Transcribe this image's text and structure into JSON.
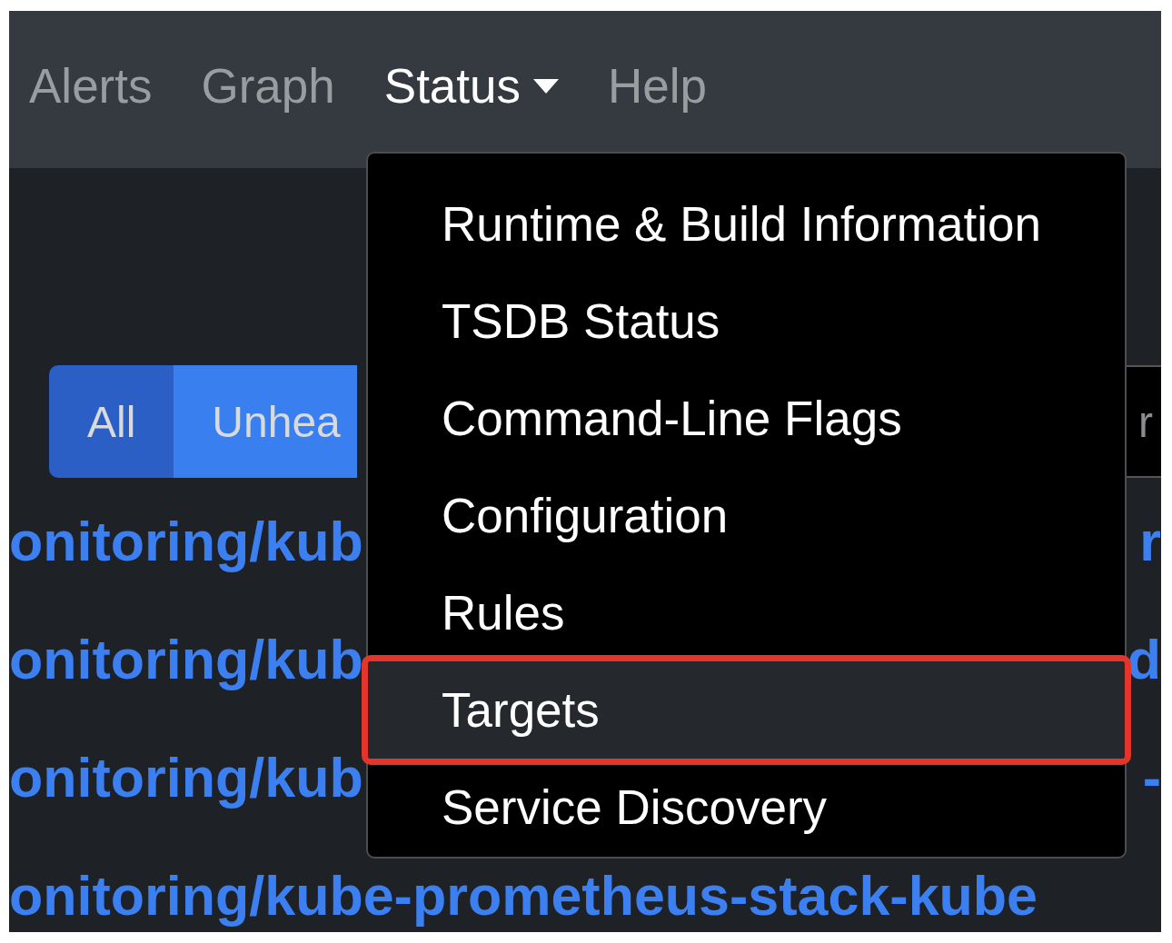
{
  "navbar": {
    "items": [
      {
        "label": "Alerts",
        "kind": "link",
        "active": false
      },
      {
        "label": "Graph",
        "kind": "link",
        "active": false
      },
      {
        "label": "Status",
        "kind": "dropdown",
        "active": true
      },
      {
        "label": "Help",
        "kind": "link",
        "active": false
      }
    ]
  },
  "filter_buttons": [
    {
      "label": "All",
      "selected": true
    },
    {
      "label": "Unhea",
      "selected": false
    }
  ],
  "search": {
    "placeholder": "r"
  },
  "rows": [
    {
      "left": "onitoring/kub",
      "right": "r"
    },
    {
      "left": "onitoring/kub",
      "right": "d"
    },
    {
      "left": "onitoring/kub",
      "right": "-"
    },
    {
      "left": "onitoring/kube-prometheus-stack-kube"
    }
  ],
  "dropdown": {
    "items": [
      {
        "label": "Runtime & Build Information",
        "highlighted": false
      },
      {
        "label": "TSDB Status",
        "highlighted": false
      },
      {
        "label": "Command-Line Flags",
        "highlighted": false
      },
      {
        "label": "Configuration",
        "highlighted": false
      },
      {
        "label": "Rules",
        "highlighted": false
      },
      {
        "label": "Targets",
        "highlighted": true
      },
      {
        "label": "Service Discovery",
        "highlighted": false
      }
    ]
  }
}
